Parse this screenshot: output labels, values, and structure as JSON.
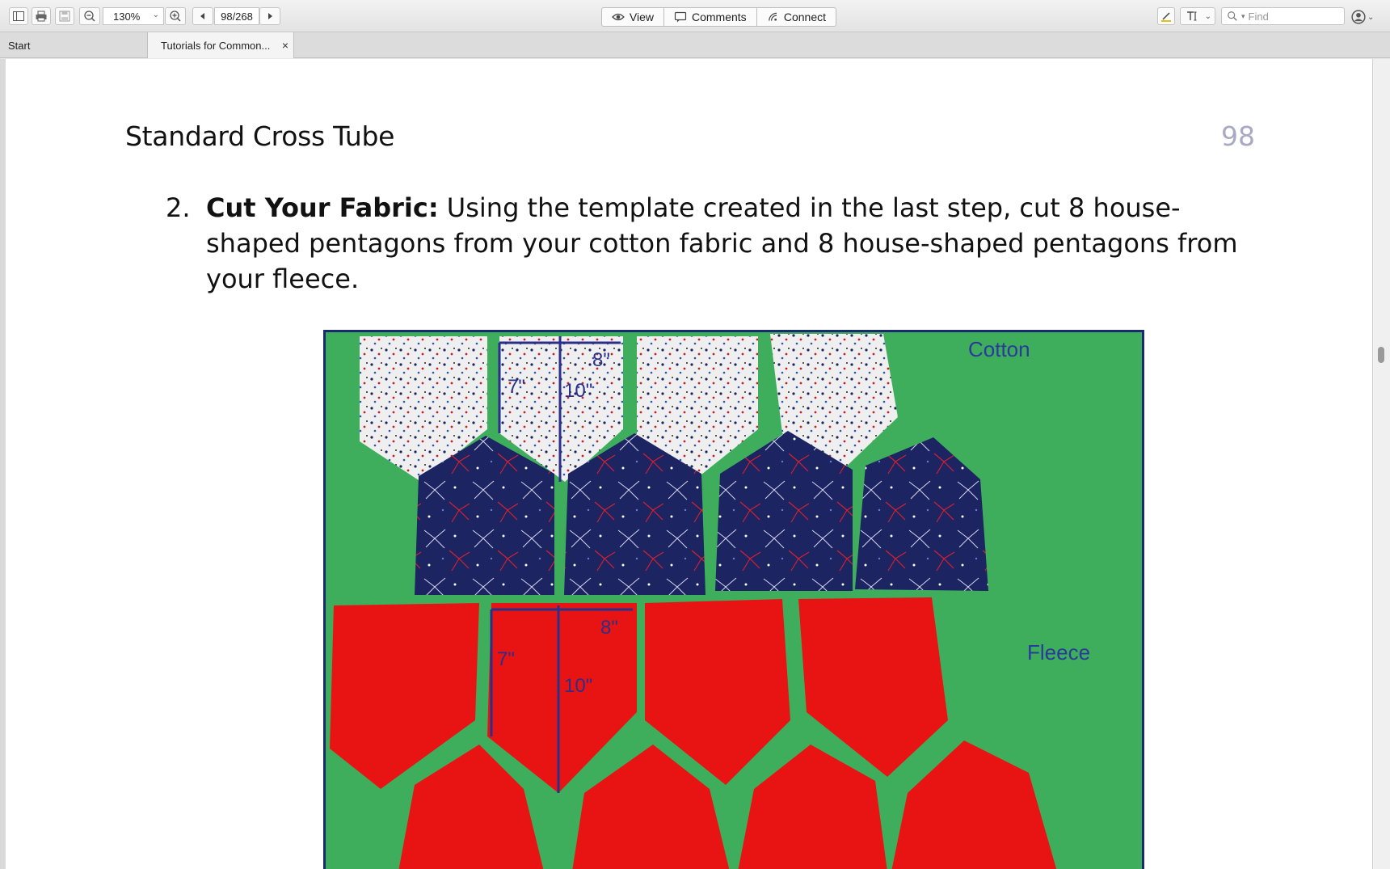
{
  "toolbar": {
    "zoom": "130%",
    "page_indicator": "98/268",
    "view_label": "View",
    "comments_label": "Comments",
    "connect_label": "Connect",
    "find_placeholder": "Find"
  },
  "tabs": [
    {
      "label": "Start"
    },
    {
      "label": "Tutorials for Common..."
    }
  ],
  "document": {
    "header_title": "Standard Cross Tube",
    "page_number": "98",
    "step_number": "2.",
    "step_bold": "Cut Your Fabric:",
    "step_text": " Using the template created in the last step, cut 8 house-shaped pentagons from your cotton fabric and 8 house-shaped pentagons from your fleece."
  },
  "photo": {
    "cotton_label": "Cotton",
    "fleece_label": "Fleece",
    "dim_top_width": "8\"",
    "dim_top_side": "7\"",
    "dim_top_height": "10\"",
    "dim_bottom_width": "8\"",
    "dim_bottom_side": "7\"",
    "dim_bottom_height": "10\"",
    "colors": {
      "background_green": "#3fae5c",
      "cotton_white": "#efefef",
      "cotton_navy": "#1c2462",
      "fleece_red": "#e81414",
      "marker_blue": "#2a2f8a"
    }
  }
}
